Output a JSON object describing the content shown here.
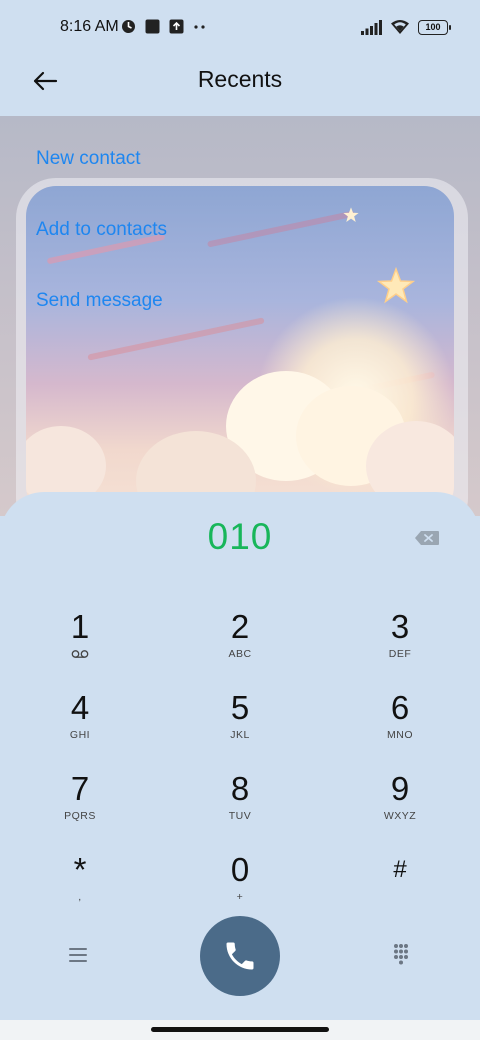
{
  "status_bar": {
    "time": "8:16 AM",
    "battery": "100",
    "icons": [
      "alarm-icon",
      "square-icon",
      "upload-icon",
      "more-dots-icon",
      "signal-icon",
      "wifi-icon",
      "battery-icon"
    ]
  },
  "header": {
    "title": "Recents",
    "back_icon": "arrow-left-icon"
  },
  "menu": {
    "new_contact": "New contact",
    "add_to_contacts": "Add to contacts",
    "send_message": "Send message"
  },
  "dialer": {
    "number": "010",
    "keys": [
      {
        "digit": "1",
        "letters": ""
      },
      {
        "digit": "2",
        "letters": "ABC"
      },
      {
        "digit": "3",
        "letters": "DEF"
      },
      {
        "digit": "4",
        "letters": "GHI"
      },
      {
        "digit": "5",
        "letters": "JKL"
      },
      {
        "digit": "6",
        "letters": "MNO"
      },
      {
        "digit": "7",
        "letters": "PQRS"
      },
      {
        "digit": "8",
        "letters": "TUV"
      },
      {
        "digit": "9",
        "letters": "WXYZ"
      },
      {
        "digit": "*",
        "letters": ","
      },
      {
        "digit": "0",
        "letters": "+"
      },
      {
        "digit": "#",
        "letters": ""
      }
    ],
    "voicemail_icon": "voicemail-icon",
    "accent_color": "#18b65a",
    "call_button_color": "#4b6b89",
    "link_color": "#1e86f0"
  }
}
